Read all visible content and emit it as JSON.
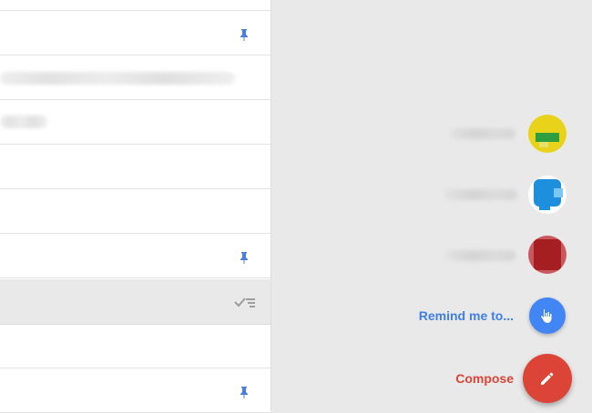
{
  "colors": {
    "accent_blue": "#4285f4",
    "remind_text": "#3f7ee8",
    "compose_red": "#db4437",
    "pin_blue": "#4a7fe0",
    "background": "#e9e9e9"
  },
  "list": {
    "rows": [
      {
        "pinned": true
      },
      {
        "pinned": false
      },
      {
        "pinned": false
      },
      {
        "pinned": false
      },
      {
        "pinned": false
      },
      {
        "pinned": true
      },
      {
        "group_header": true
      },
      {
        "pinned": false
      },
      {
        "pinned": true
      }
    ],
    "icons": {
      "pin": "pin-icon",
      "sweep": "done-all-icon"
    }
  },
  "speed_dial": {
    "contacts": [
      {
        "avatar_color": "#e8d21a",
        "avatar_accent": "#2e9e3f"
      },
      {
        "avatar_color": "#1e8fdc",
        "avatar_accent": "#7cc6f2"
      },
      {
        "avatar_color": "#a51e22",
        "avatar_accent": "#c9595c"
      }
    ],
    "remind": {
      "label": "Remind me to...",
      "icon": "remind-hand-icon"
    },
    "compose": {
      "label": "Compose",
      "icon": "pencil-icon"
    }
  }
}
